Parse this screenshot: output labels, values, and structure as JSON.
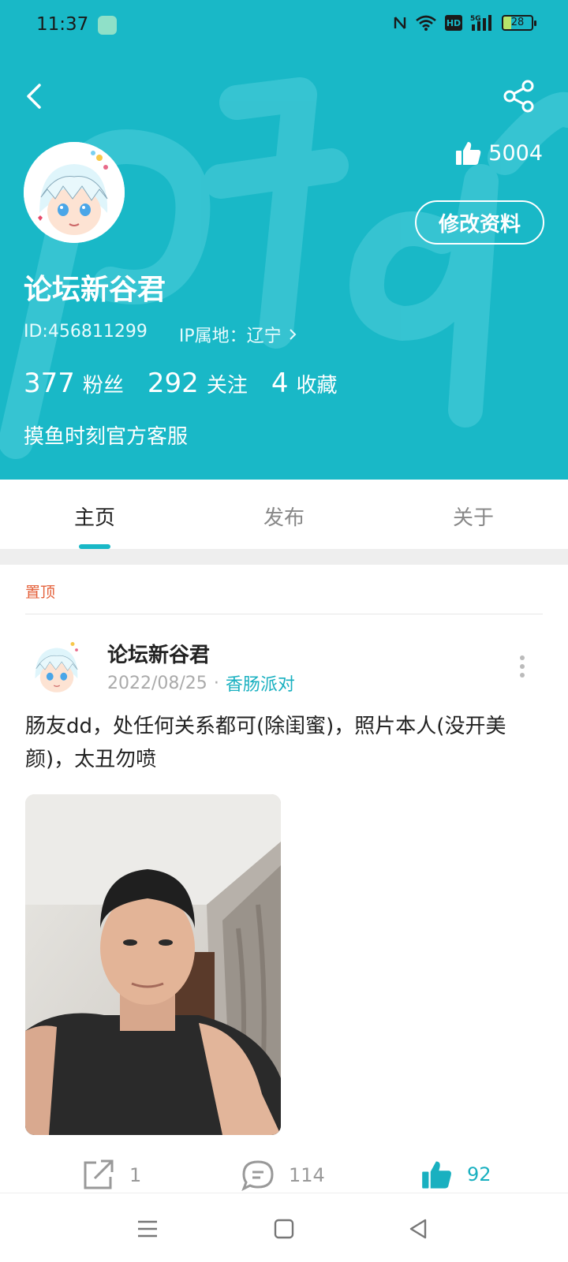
{
  "status_bar": {
    "time": "11:37",
    "battery": "28"
  },
  "profile": {
    "like_count": "5004",
    "edit_label": "修改资料",
    "username": "论坛新谷君",
    "id_text": "ID:456811299",
    "ip_text": "IP属地：辽宁",
    "stats": [
      {
        "num": "377",
        "label": "粉丝"
      },
      {
        "num": "292",
        "label": "关注"
      },
      {
        "num": "4",
        "label": "收藏"
      }
    ],
    "bio": "摸鱼时刻官方客服"
  },
  "tabs": [
    {
      "label": "主页",
      "active": true
    },
    {
      "label": "发布",
      "active": false
    },
    {
      "label": "关于",
      "active": false
    }
  ],
  "feed": {
    "pinned_label": "置顶",
    "post": {
      "author": "论坛新谷君",
      "date": "2022/08/25",
      "topic": "香肠派对",
      "text": "肠友dd，处任何关系都可(除闺蜜)，照片本人(没开美颜)，太丑勿喷",
      "share_count": "1",
      "comment_count": "114",
      "like_count": "92"
    }
  },
  "colors": {
    "accent": "#19b8c7",
    "pinned": "#e4603a"
  }
}
